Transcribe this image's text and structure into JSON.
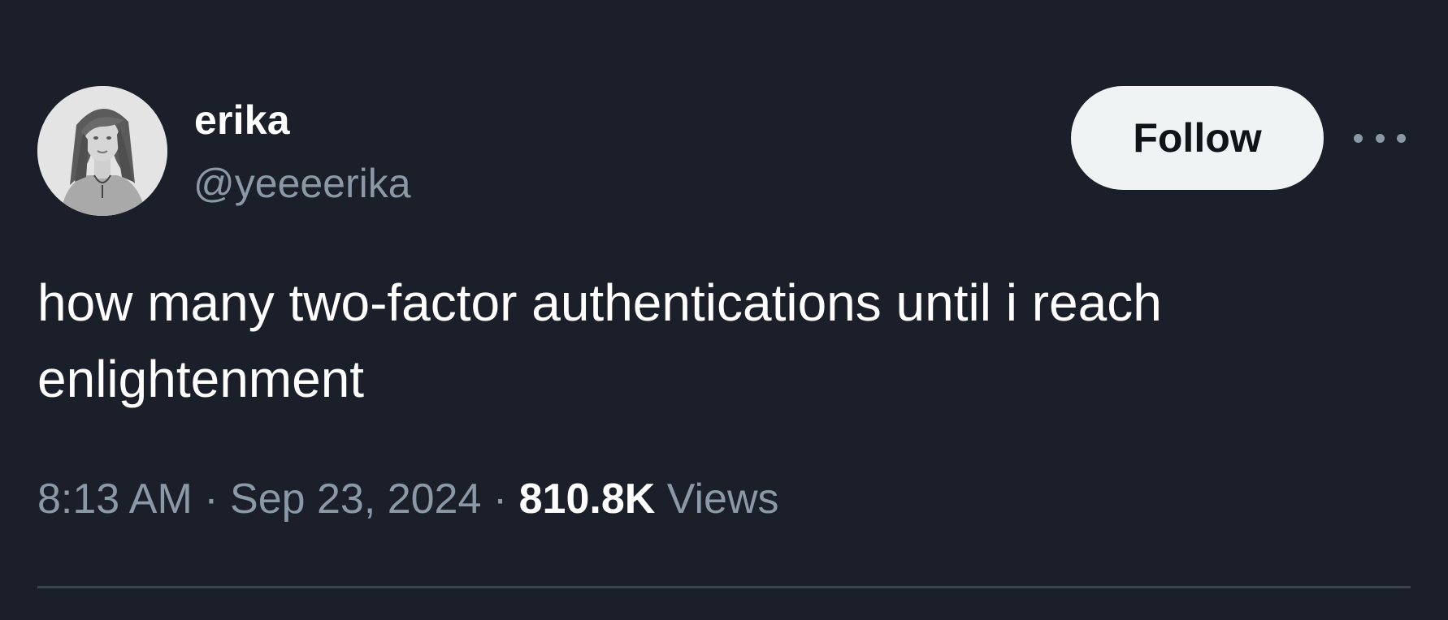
{
  "author": {
    "display_name": "erika",
    "handle": "@yeeeerika",
    "avatar_icon": "user-avatar-photo"
  },
  "actions": {
    "follow_label": "Follow",
    "more_icon": "more-horizontal-icon"
  },
  "tweet": {
    "text_line1": "how many two-factor authentications until i reach",
    "text_line2": "enlightenment"
  },
  "meta": {
    "time": "8:13 AM",
    "separator1": " · ",
    "date": "Sep 23, 2024",
    "separator2": " · ",
    "views_count": "810.8K",
    "views_label": " Views"
  },
  "colors": {
    "background": "#1a1f29",
    "text_primary": "#ffffff",
    "text_secondary": "#8b98a5",
    "follow_button_bg": "#eff3f4",
    "follow_button_text": "#0f1419"
  }
}
